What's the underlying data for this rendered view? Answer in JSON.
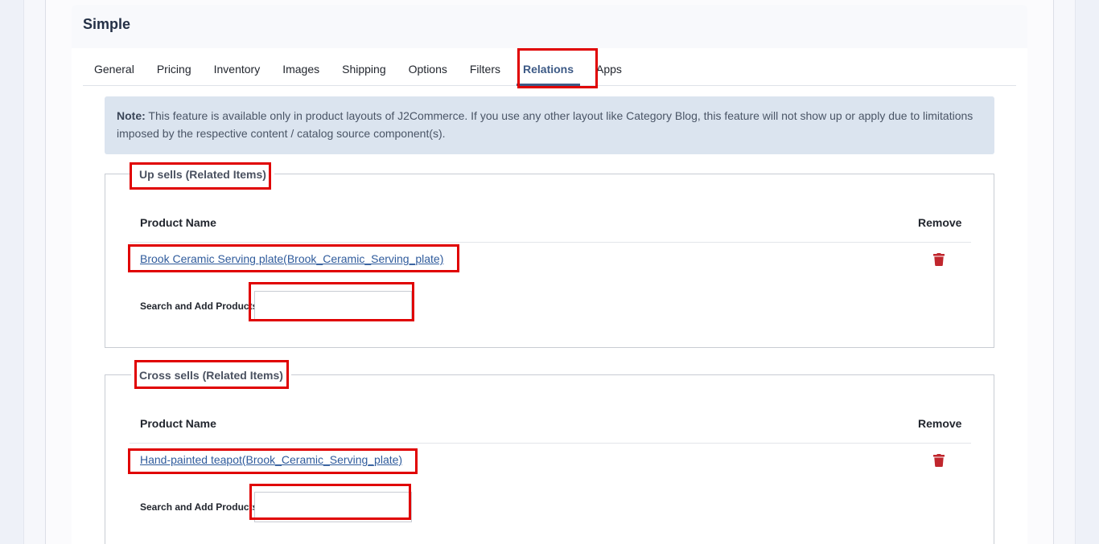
{
  "page": {
    "title": "Simple"
  },
  "tabs": [
    {
      "label": "General"
    },
    {
      "label": "Pricing"
    },
    {
      "label": "Inventory"
    },
    {
      "label": "Images"
    },
    {
      "label": "Shipping"
    },
    {
      "label": "Options"
    },
    {
      "label": "Filters"
    },
    {
      "label": "Relations",
      "active": true
    },
    {
      "label": "Apps"
    }
  ],
  "note": {
    "prefix": "Note:",
    "text": " This feature is available only in product layouts of J2Commerce. If you use any other layout like Category Blog, this feature will not show up or apply due to limitations imposed by the respective content / catalog source component(s)."
  },
  "upsells": {
    "legend": "Up sells (Related Items)",
    "col_product": "Product Name",
    "col_remove": "Remove",
    "items": [
      {
        "name": "Brook Ceramic Serving plate(Brook_Ceramic_Serving_plate)"
      }
    ],
    "search_label": "Search and Add Products",
    "search_value": ""
  },
  "crosssells": {
    "legend": "Cross sells (Related Items)",
    "col_product": "Product Name",
    "col_remove": "Remove",
    "items": [
      {
        "name": "Hand-painted teapot(Brook_Ceramic_Serving_plate)"
      }
    ],
    "search_label": "Search and Add Products",
    "search_value": ""
  },
  "colors": {
    "accent": "#3d5a86",
    "link": "#2f5b9c",
    "danger": "#c0262d",
    "highlight": "#e00000",
    "note_bg": "#dbe4ef"
  },
  "icons": {
    "remove": "trash-icon"
  }
}
